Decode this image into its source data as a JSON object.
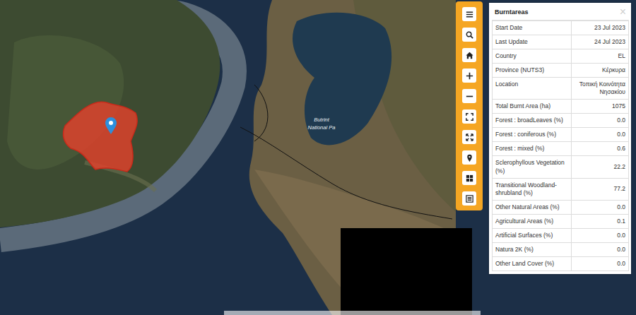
{
  "map": {
    "park_label": [
      "Butrint",
      "National Pa"
    ]
  },
  "panel": {
    "title": "Burntareas",
    "close": "×",
    "rows": [
      {
        "label": "Start Date",
        "value": "23 Jul 2023"
      },
      {
        "label": "Last Update",
        "value": "24 Jul 2023"
      },
      {
        "label": "Country",
        "value": "EL"
      },
      {
        "label": "Province (NUTS3)",
        "value": "Κέρκυρα"
      },
      {
        "label": "Location",
        "value": "Τοπική Κοινότητα Νησακίου"
      },
      {
        "label": "Total Burnt Area (ha)",
        "value": "1075"
      },
      {
        "label": "Forest : broadLeaves (%)",
        "value": "0.0"
      },
      {
        "label": "Forest : coniferous (%)",
        "value": "0.0"
      },
      {
        "label": "Forest : mixed (%)",
        "value": "0.6"
      },
      {
        "label": "Sclerophyllous Vegetation (%)",
        "value": "22.2"
      },
      {
        "label": "Transitional Woodland-shrubland (%)",
        "value": "77.2"
      },
      {
        "label": "Other Natural Areas (%)",
        "value": "0.0"
      },
      {
        "label": "Agricultural Areas (%)",
        "value": "0.1"
      },
      {
        "label": "Artificial Surfaces (%)",
        "value": "0.0"
      },
      {
        "label": "Natura 2K (%)",
        "value": "0.0"
      },
      {
        "label": "Other Land Cover (%)",
        "value": "0.0"
      }
    ]
  }
}
